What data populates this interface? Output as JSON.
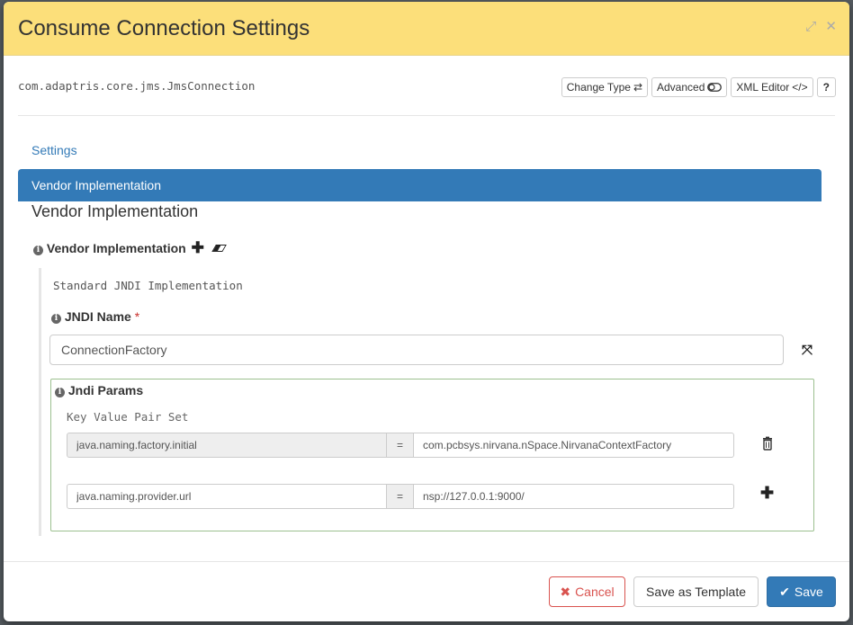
{
  "modal": {
    "title": "Consume Connection Settings",
    "class_name": "com.adaptris.core.jms.JmsConnection"
  },
  "toolbar": {
    "change_type": "Change Type",
    "advanced": "Advanced",
    "xml_editor": "XML Editor",
    "help": "?"
  },
  "nav": {
    "settings": "Settings",
    "active_section": "Vendor Implementation"
  },
  "section": {
    "title": "Vendor Implementation",
    "field_label": "Vendor Implementation",
    "implementation_type": "Standard JNDI Implementation"
  },
  "jndi_name": {
    "label": "JNDI Name",
    "required_marker": "*",
    "value": "ConnectionFactory"
  },
  "jndi_params": {
    "label": "Jndi Params",
    "type": "Key Value Pair Set",
    "equals": "=",
    "rows": [
      {
        "key": "java.naming.factory.initial",
        "value": "com.pcbsys.nirvana.nSpace.NirvanaContextFactory"
      },
      {
        "key": "java.naming.provider.url",
        "value": "nsp://127.0.0.1:9000/"
      }
    ]
  },
  "footer": {
    "cancel": "Cancel",
    "save_template": "Save as Template",
    "save": "Save"
  },
  "colors": {
    "header_bg": "#fcdf7a",
    "primary": "#337ab7",
    "danger": "#d9534f",
    "params_border": "#9cc08f"
  }
}
